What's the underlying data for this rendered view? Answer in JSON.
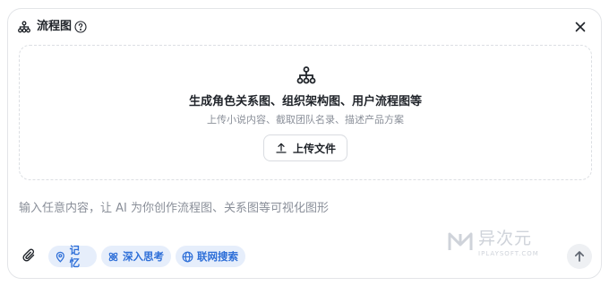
{
  "header": {
    "title": "流程图",
    "icons": {
      "flow": "flowchart-icon",
      "help": "help-icon",
      "close": "close-icon"
    }
  },
  "dropzone": {
    "icon": "flowchart-icon",
    "title": "生成角色关系图、组织架构图、用户流程图等",
    "subtitle": "上传小说内容、截取团队名录、描述产品方案",
    "upload_label": "上传文件",
    "upload_icon": "upload-icon"
  },
  "input": {
    "placeholder": "输入任意内容，让 AI 为你创作流程图、关系图等可视化图形"
  },
  "toolbar": {
    "attach_icon": "paperclip-icon",
    "chips": [
      {
        "label": "记忆",
        "icon": "memory-pin-icon"
      },
      {
        "label": "深入思考",
        "icon": "deep-think-icon"
      },
      {
        "label": "联网搜索",
        "icon": "globe-icon"
      }
    ],
    "send_icon": "arrow-up-icon"
  },
  "watermark": {
    "text": "异次元",
    "subtext": "IPLAYSOFT.COM"
  },
  "colors": {
    "accent": "#2e6fd8",
    "chip_bg": "#e6eefb",
    "muted_text": "#8a8f99",
    "border": "#e3e5e8"
  }
}
